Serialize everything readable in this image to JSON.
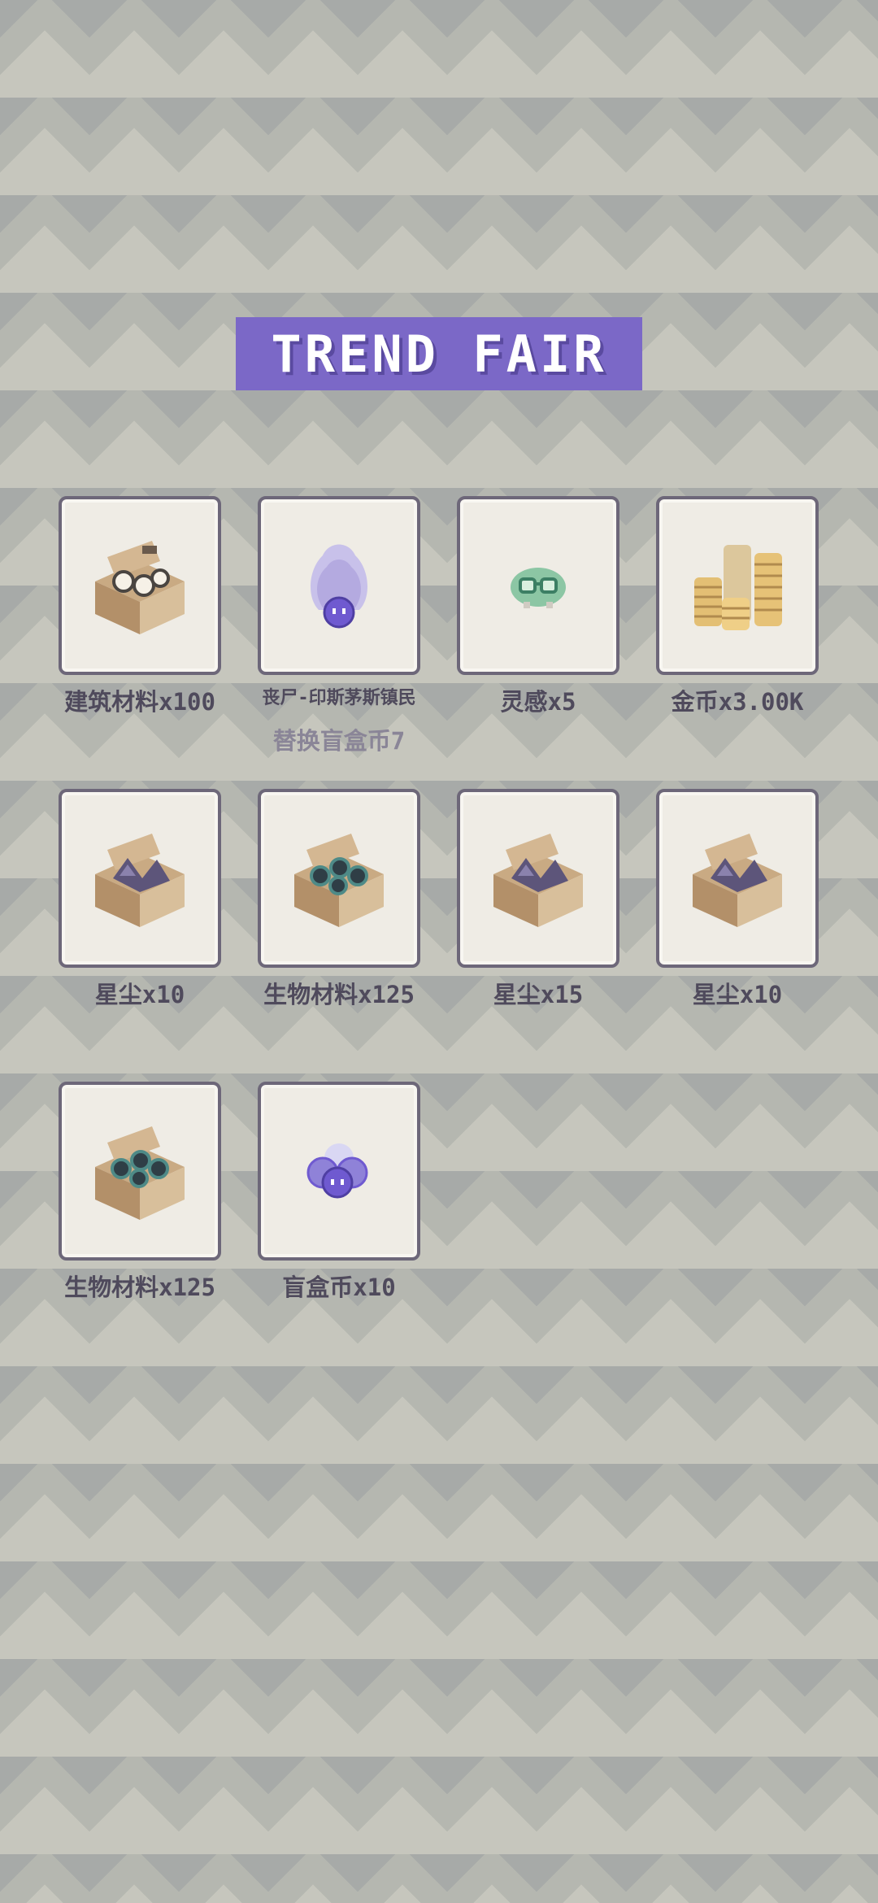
{
  "header": {
    "title": "TREND FAIR"
  },
  "rewards": [
    {
      "name": "建筑材料x100",
      "icon": "building-materials-crate-icon"
    },
    {
      "name": "丧尸-印斯茅斯镇民",
      "note": "替换盲盒币7",
      "icon": "ghost-zombie-icon"
    },
    {
      "name": "灵感x5",
      "icon": "inspiration-icon"
    },
    {
      "name": "金币x3.00K",
      "icon": "gold-coins-icon"
    },
    {
      "name": "星尘x10",
      "icon": "stardust-crate-icon"
    },
    {
      "name": "生物材料x125",
      "icon": "bio-materials-crate-icon"
    },
    {
      "name": "星尘x15",
      "icon": "stardust-crate-icon"
    },
    {
      "name": "星尘x10",
      "icon": "stardust-crate-icon"
    },
    {
      "name": "生物材料x125",
      "icon": "bio-materials-crate-icon"
    },
    {
      "name": "盲盒币x10",
      "icon": "blind-box-coin-icon"
    }
  ],
  "colors": {
    "accent": "#7b68c7",
    "card_border": "#6d6779",
    "card_fill": "#efece5",
    "label": "#4f4a5c",
    "sublabel": "#8a8597"
  }
}
